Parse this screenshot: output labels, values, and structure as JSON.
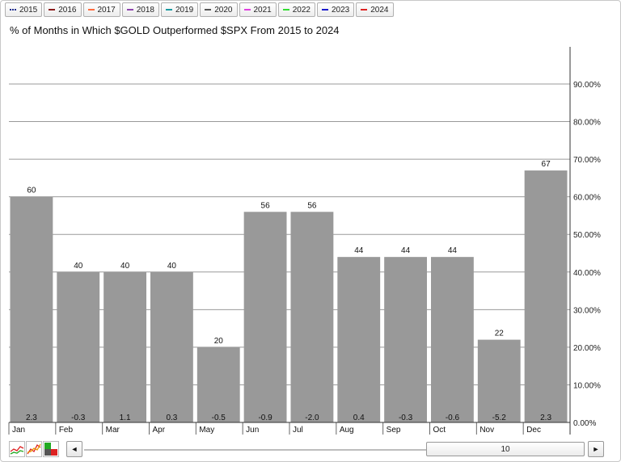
{
  "legend": [
    {
      "label": "2015",
      "color": "#1f2f8f"
    },
    {
      "label": "2016",
      "color": "#8b1a1a"
    },
    {
      "label": "2017",
      "color": "#ff6a3d"
    },
    {
      "label": "2018",
      "color": "#8e44ad"
    },
    {
      "label": "2019",
      "color": "#1a9aa0"
    },
    {
      "label": "2020",
      "color": "#555555"
    },
    {
      "label": "2021",
      "color": "#e040e0"
    },
    {
      "label": "2022",
      "color": "#33dd33"
    },
    {
      "label": "2023",
      "color": "#1a1acc"
    },
    {
      "label": "2024",
      "color": "#dd2222"
    }
  ],
  "chart_data": {
    "type": "bar",
    "title": "% of Months in Which $GOLD Outperformed $SPX From 2015 to 2024",
    "categories": [
      "Jan",
      "Feb",
      "Mar",
      "Apr",
      "May",
      "Jun",
      "Jul",
      "Aug",
      "Sep",
      "Oct",
      "Nov",
      "Dec"
    ],
    "values": [
      60,
      40,
      40,
      40,
      20,
      56,
      56,
      44,
      44,
      44,
      22,
      67
    ],
    "bar_top_labels": [
      "60",
      "40",
      "40",
      "40",
      "20",
      "56",
      "56",
      "44",
      "44",
      "44",
      "22",
      "67"
    ],
    "bar_bottom_labels": [
      "2.3",
      "-0.3",
      "1.1",
      "0.3",
      "-0.5",
      "-0.9",
      "-2.0",
      "0.4",
      "-0.3",
      "-0.6",
      "-5.2",
      "2.3"
    ],
    "ylim": [
      0,
      100
    ],
    "yticks": [
      0,
      10,
      20,
      30,
      40,
      50,
      60,
      70,
      80,
      90
    ],
    "ytick_labels": [
      "0.00%",
      "10.00%",
      "20.00%",
      "30.00%",
      "40.00%",
      "50.00%",
      "60.00%",
      "70.00%",
      "80.00%",
      "90.00%"
    ],
    "y_axis_side": "right",
    "grid": true,
    "bar_color": "#999999"
  },
  "toolbar": {
    "scroll_prev": "◄",
    "scroll_next": "►",
    "range_value": "10"
  }
}
